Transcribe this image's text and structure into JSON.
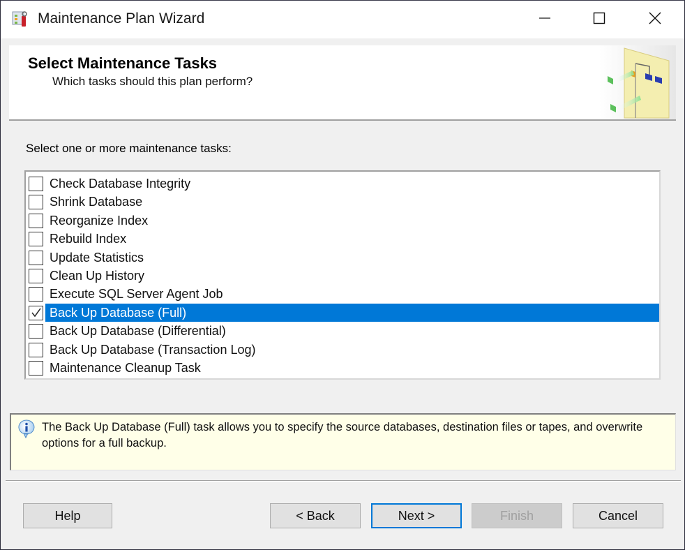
{
  "window": {
    "title": "Maintenance Plan Wizard",
    "app_icon": "wizard-app-icon",
    "controls": [
      "minimize-icon",
      "maximize-icon",
      "close-icon"
    ]
  },
  "header": {
    "title": "Select Maintenance Tasks",
    "subtitle": "Which tasks should this plan perform?",
    "art": "maintenance-plan-graphic"
  },
  "prompt": "Select one or more maintenance tasks:",
  "tasks": [
    {
      "label": "Check Database Integrity",
      "checked": false,
      "selected": false
    },
    {
      "label": "Shrink Database",
      "checked": false,
      "selected": false
    },
    {
      "label": "Reorganize Index",
      "checked": false,
      "selected": false
    },
    {
      "label": "Rebuild Index",
      "checked": false,
      "selected": false
    },
    {
      "label": "Update Statistics",
      "checked": false,
      "selected": false
    },
    {
      "label": "Clean Up History",
      "checked": false,
      "selected": false
    },
    {
      "label": "Execute SQL Server Agent Job",
      "checked": false,
      "selected": false
    },
    {
      "label": "Back Up Database (Full)",
      "checked": true,
      "selected": true
    },
    {
      "label": "Back Up Database (Differential)",
      "checked": false,
      "selected": false
    },
    {
      "label": "Back Up Database (Transaction Log)",
      "checked": false,
      "selected": false
    },
    {
      "label": "Maintenance Cleanup Task",
      "checked": false,
      "selected": false
    }
  ],
  "info": {
    "icon": "info-icon",
    "text": "The Back Up Database (Full) task allows you to specify the source databases, destination files or tapes, and overwrite options for a full backup."
  },
  "buttons": {
    "help": "Help",
    "back": "< Back",
    "next": "Next >",
    "finish": "Finish",
    "cancel": "Cancel"
  },
  "colors": {
    "selection": "#0078d7",
    "info_background": "#ffffe8",
    "focus_border": "#0078d7"
  }
}
